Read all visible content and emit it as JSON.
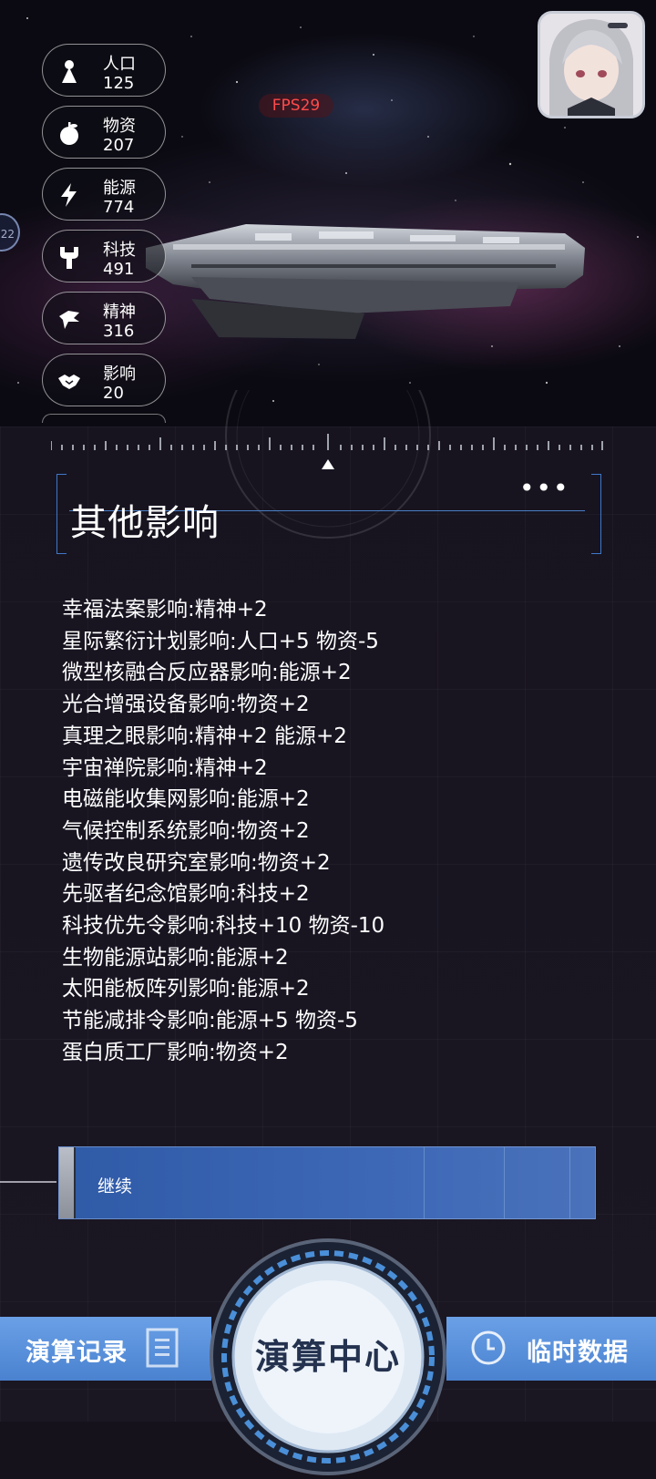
{
  "top": {
    "fps": "FPS29",
    "side_badge": "22",
    "resources": [
      {
        "icon": "person-icon",
        "label": "人口",
        "value": "125"
      },
      {
        "icon": "apple-icon",
        "label": "物资",
        "value": "207"
      },
      {
        "icon": "lightning-icon",
        "label": "能源",
        "value": "774"
      },
      {
        "icon": "wrench-icon",
        "label": "科技",
        "value": "491"
      },
      {
        "icon": "spirit-icon",
        "label": "精神",
        "value": "316"
      },
      {
        "icon": "handshake-icon",
        "label": "影响",
        "value": "20"
      }
    ]
  },
  "panel": {
    "title": "其他影响",
    "effects": [
      "幸福法案影响:精神+2",
      "星际繁衍计划影响:人口+5 物资-5",
      "微型核融合反应器影响:能源+2",
      "光合增强设备影响:物资+2",
      "真理之眼影响:精神+2 能源+2",
      "宇宙禅院影响:精神+2",
      "电磁能收集网影响:能源+2",
      "气候控制系统影响:物资+2",
      "遗传改良研究室影响:物资+2",
      "先驱者纪念馆影响:科技+2",
      "科技优先令影响:科技+10 物资-10",
      "生物能源站影响:能源+2",
      "太阳能板阵列影响:能源+2",
      "节能减排令影响:能源+5 物资-5",
      "蛋白质工厂影响:物资+2"
    ],
    "continue_label": "继续"
  },
  "nav": {
    "left_label": "演算记录",
    "center_label": "演算中心",
    "right_label": "临时数据"
  },
  "colors": {
    "accent_blue": "#4a82d0",
    "fps_red": "#ff4b4b",
    "frame_blue": "#3f78c8"
  }
}
